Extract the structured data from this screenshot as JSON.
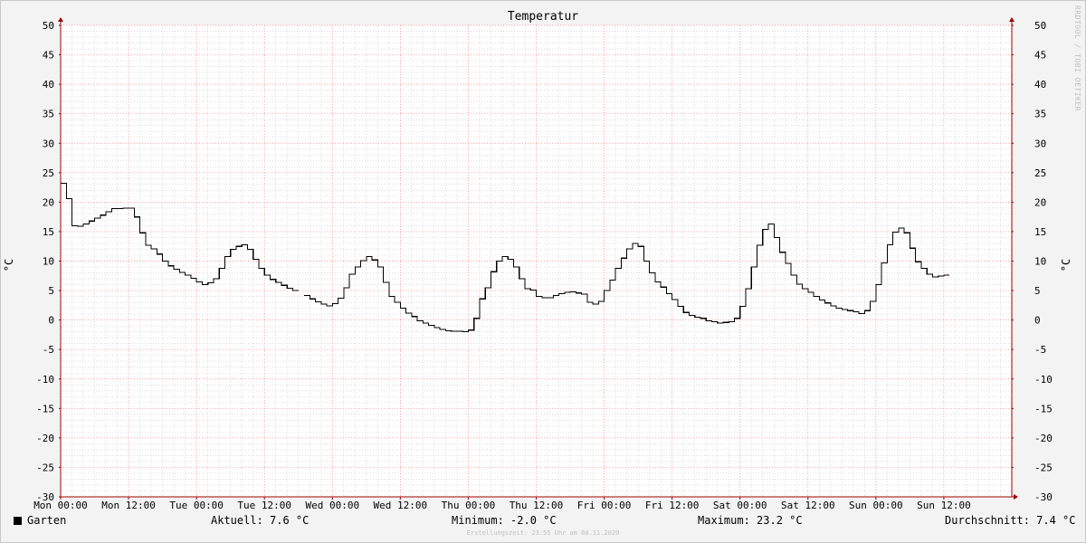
{
  "chart_data": {
    "type": "line",
    "title": "Temperatur",
    "ylabel": "°C",
    "ylim": [
      -30,
      50
    ],
    "y_ticks": [
      50,
      45,
      40,
      35,
      30,
      25,
      20,
      15,
      10,
      5,
      0,
      -5,
      -10,
      -15,
      -20,
      -25,
      -30
    ],
    "x_range_hours": [
      0,
      168
    ],
    "x_ticks": [
      {
        "label": "Mon 00:00",
        "hour": 0
      },
      {
        "label": "Mon 12:00",
        "hour": 12
      },
      {
        "label": "Tue 00:00",
        "hour": 24
      },
      {
        "label": "Tue 12:00",
        "hour": 36
      },
      {
        "label": "Wed 00:00",
        "hour": 48
      },
      {
        "label": "Wed 12:00",
        "hour": 60
      },
      {
        "label": "Thu 00:00",
        "hour": 72
      },
      {
        "label": "Thu 12:00",
        "hour": 84
      },
      {
        "label": "Fri 00:00",
        "hour": 96
      },
      {
        "label": "Fri 12:00",
        "hour": 108
      },
      {
        "label": "Sat 00:00",
        "hour": 120
      },
      {
        "label": "Sat 12:00",
        "hour": 132
      },
      {
        "label": "Sun 00:00",
        "hour": 144
      },
      {
        "label": "Sun 12:00",
        "hour": 156
      }
    ],
    "grid": true,
    "legend": "bottom-left",
    "series": [
      {
        "name": "Garten",
        "color": "#000000",
        "points": [
          [
            0,
            23.2
          ],
          [
            1,
            20.6
          ],
          [
            2,
            16.0
          ],
          [
            3,
            15.9
          ],
          [
            4,
            16.3
          ],
          [
            5,
            16.8
          ],
          [
            6,
            17.3
          ],
          [
            7,
            17.8
          ],
          [
            8,
            18.4
          ],
          [
            9,
            18.9
          ],
          [
            10,
            18.9
          ],
          [
            11,
            19.0
          ],
          [
            12,
            19.0
          ],
          [
            13,
            17.5
          ],
          [
            14,
            14.8
          ],
          [
            15,
            12.7
          ],
          [
            16,
            12.1
          ],
          [
            17,
            11.2
          ],
          [
            18,
            10.0
          ],
          [
            19,
            9.2
          ],
          [
            20,
            8.6
          ],
          [
            21,
            8.1
          ],
          [
            22,
            7.6
          ],
          [
            23,
            7.1
          ],
          [
            24,
            6.5
          ],
          [
            25,
            6.0
          ],
          [
            26,
            6.3
          ],
          [
            27,
            7.0
          ],
          [
            28,
            8.8
          ],
          [
            29,
            10.8
          ],
          [
            30,
            12.0
          ],
          [
            31,
            12.5
          ],
          [
            32,
            12.8
          ],
          [
            33,
            12.0
          ],
          [
            34,
            10.3
          ],
          [
            35,
            8.8
          ],
          [
            36,
            7.6
          ],
          [
            37,
            6.9
          ],
          [
            38,
            6.4
          ],
          [
            39,
            5.9
          ],
          [
            40,
            5.4
          ],
          [
            41,
            5.0
          ],
          [
            42,
            null
          ],
          [
            43,
            4.2
          ],
          [
            44,
            3.6
          ],
          [
            45,
            3.1
          ],
          [
            46,
            2.7
          ],
          [
            47,
            2.4
          ],
          [
            48,
            2.8
          ],
          [
            49,
            3.7
          ],
          [
            50,
            5.5
          ],
          [
            51,
            7.8
          ],
          [
            52,
            9.0
          ],
          [
            53,
            10.1
          ],
          [
            54,
            10.8
          ],
          [
            55,
            10.2
          ],
          [
            56,
            9.0
          ],
          [
            57,
            6.4
          ],
          [
            58,
            4.0
          ],
          [
            59,
            3.0
          ],
          [
            60,
            2.0
          ],
          [
            61,
            1.2
          ],
          [
            62,
            0.6
          ],
          [
            63,
            -0.1
          ],
          [
            64,
            -0.5
          ],
          [
            65,
            -0.9
          ],
          [
            66,
            -1.3
          ],
          [
            67,
            -1.6
          ],
          [
            68,
            -1.8
          ],
          [
            69,
            -1.9
          ],
          [
            70,
            -1.9
          ],
          [
            71,
            -2.0
          ],
          [
            72,
            -1.7
          ],
          [
            73,
            0.3
          ],
          [
            74,
            3.6
          ],
          [
            75,
            5.5
          ],
          [
            76,
            8.2
          ],
          [
            77,
            10.0
          ],
          [
            78,
            10.8
          ],
          [
            79,
            10.3
          ],
          [
            80,
            9.0
          ],
          [
            81,
            7.0
          ],
          [
            82,
            5.3
          ],
          [
            83,
            5.1
          ],
          [
            84,
            4.0
          ],
          [
            85,
            3.8
          ],
          [
            86,
            3.8
          ],
          [
            87,
            4.2
          ],
          [
            88,
            4.5
          ],
          [
            89,
            4.7
          ],
          [
            90,
            4.8
          ],
          [
            91,
            4.6
          ],
          [
            92,
            4.4
          ],
          [
            93,
            3.0
          ],
          [
            94,
            2.7
          ],
          [
            95,
            3.2
          ],
          [
            96,
            5.0
          ],
          [
            97,
            6.8
          ],
          [
            98,
            8.8
          ],
          [
            99,
            10.5
          ],
          [
            100,
            12.1
          ],
          [
            101,
            13.0
          ],
          [
            102,
            12.5
          ],
          [
            103,
            10.0
          ],
          [
            104,
            8.0
          ],
          [
            105,
            6.5
          ],
          [
            106,
            5.6
          ],
          [
            107,
            4.5
          ],
          [
            108,
            3.5
          ],
          [
            109,
            2.3
          ],
          [
            110,
            1.3
          ],
          [
            111,
            0.8
          ],
          [
            112,
            0.5
          ],
          [
            113,
            0.3
          ],
          [
            114,
            -0.1
          ],
          [
            115,
            -0.3
          ],
          [
            116,
            -0.5
          ],
          [
            117,
            -0.4
          ],
          [
            118,
            -0.3
          ],
          [
            119,
            0.3
          ],
          [
            120,
            2.3
          ],
          [
            121,
            5.3
          ],
          [
            122,
            9.0
          ],
          [
            123,
            12.7
          ],
          [
            124,
            15.4
          ],
          [
            125,
            16.3
          ],
          [
            126,
            14.0
          ],
          [
            127,
            11.5
          ],
          [
            128,
            9.6
          ],
          [
            129,
            7.6
          ],
          [
            130,
            6.1
          ],
          [
            131,
            5.3
          ],
          [
            132,
            4.7
          ],
          [
            133,
            4.0
          ],
          [
            134,
            3.4
          ],
          [
            135,
            2.9
          ],
          [
            136,
            2.4
          ],
          [
            137,
            2.0
          ],
          [
            138,
            1.8
          ],
          [
            139,
            1.6
          ],
          [
            140,
            1.4
          ],
          [
            141,
            1.1
          ],
          [
            142,
            1.6
          ],
          [
            143,
            3.2
          ],
          [
            144,
            6.0
          ],
          [
            145,
            9.7
          ],
          [
            146,
            12.8
          ],
          [
            147,
            14.9
          ],
          [
            148,
            15.6
          ],
          [
            149,
            14.8
          ],
          [
            150,
            12.2
          ],
          [
            151,
            9.9
          ],
          [
            152,
            8.8
          ],
          [
            153,
            7.8
          ],
          [
            154,
            7.3
          ],
          [
            155,
            7.5
          ],
          [
            156,
            7.6
          ]
        ]
      }
    ]
  },
  "legend": {
    "series_label": "Garten",
    "current": "Aktuell: 7.6 °C",
    "minimum": "Minimum: -2.0 °C",
    "maximum": "Maximum: 23.2 °C",
    "average": "Durchschnitt: 7.4 °C"
  },
  "watermark": "RRDTOOL / TOBI OETIKER",
  "footer": "Erstellungszeit: 23:55 Uhr am 08.11.2020",
  "colors": {
    "background": "#f3f3f3",
    "plot_background": "#ffffff",
    "major_grid": "#ff8080",
    "minor_grid": "#c8c8c8",
    "axis": "#a00000",
    "line": "#000000"
  }
}
